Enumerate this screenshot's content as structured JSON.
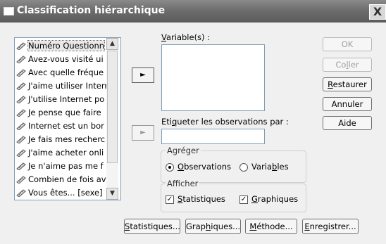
{
  "window": {
    "title": "Classification hiérarchique",
    "close_glyph": "X"
  },
  "variables_list": {
    "items": [
      "Numéro Questionn",
      "Avez-vous visité ui",
      "Avec quelle fréque",
      "J'aime utiliser Interr",
      "J'utilise Internet po",
      "Je pense que faire",
      "Internet est un bor",
      "Je fais mes recherc",
      "J'aime acheter onli",
      "Je n'aime pas me f",
      "Combien de fois av",
      "Vous êtes... [sexe]"
    ],
    "selected_index": 0
  },
  "variables_field": {
    "label_u": "V",
    "label_rest": "ariable(s) :"
  },
  "label_field": {
    "label_pre": "Eti",
    "label_u": "q",
    "label_rest": "ueter les observations par :",
    "value": ""
  },
  "aggregate_group": {
    "legend": "Agréger",
    "observations": {
      "u": "O",
      "rest": "bservations",
      "selected": true
    },
    "variables": {
      "pre": "Varia",
      "u": "b",
      "rest": "les",
      "selected": false
    }
  },
  "display_group": {
    "legend": "Afficher",
    "statistics": {
      "u": "S",
      "rest": "tatistiques",
      "checked": true
    },
    "graphics": {
      "u": "G",
      "rest": "raphiques",
      "checked": true
    }
  },
  "side_buttons": {
    "ok": "OK",
    "paste": {
      "pre": "Co",
      "u": "l",
      "rest": "ler"
    },
    "reset": {
      "u": "R",
      "rest": "estaurer"
    },
    "cancel": "Annuler",
    "help": "Aide"
  },
  "bottom_buttons": {
    "statistics": {
      "u": "S",
      "rest": "tatistiques..."
    },
    "graphics": {
      "pre": "Grap",
      "u": "h",
      "rest": "iques..."
    },
    "method": {
      "u": "M",
      "rest": "éthode..."
    },
    "save": {
      "u": "E",
      "rest": "nregistrer..."
    }
  },
  "glyphs": {
    "arrow_right": "►",
    "scroll_up": "▲",
    "scroll_down": "▼",
    "check": "✓"
  },
  "icons": {
    "variable": "ruler-icon"
  }
}
